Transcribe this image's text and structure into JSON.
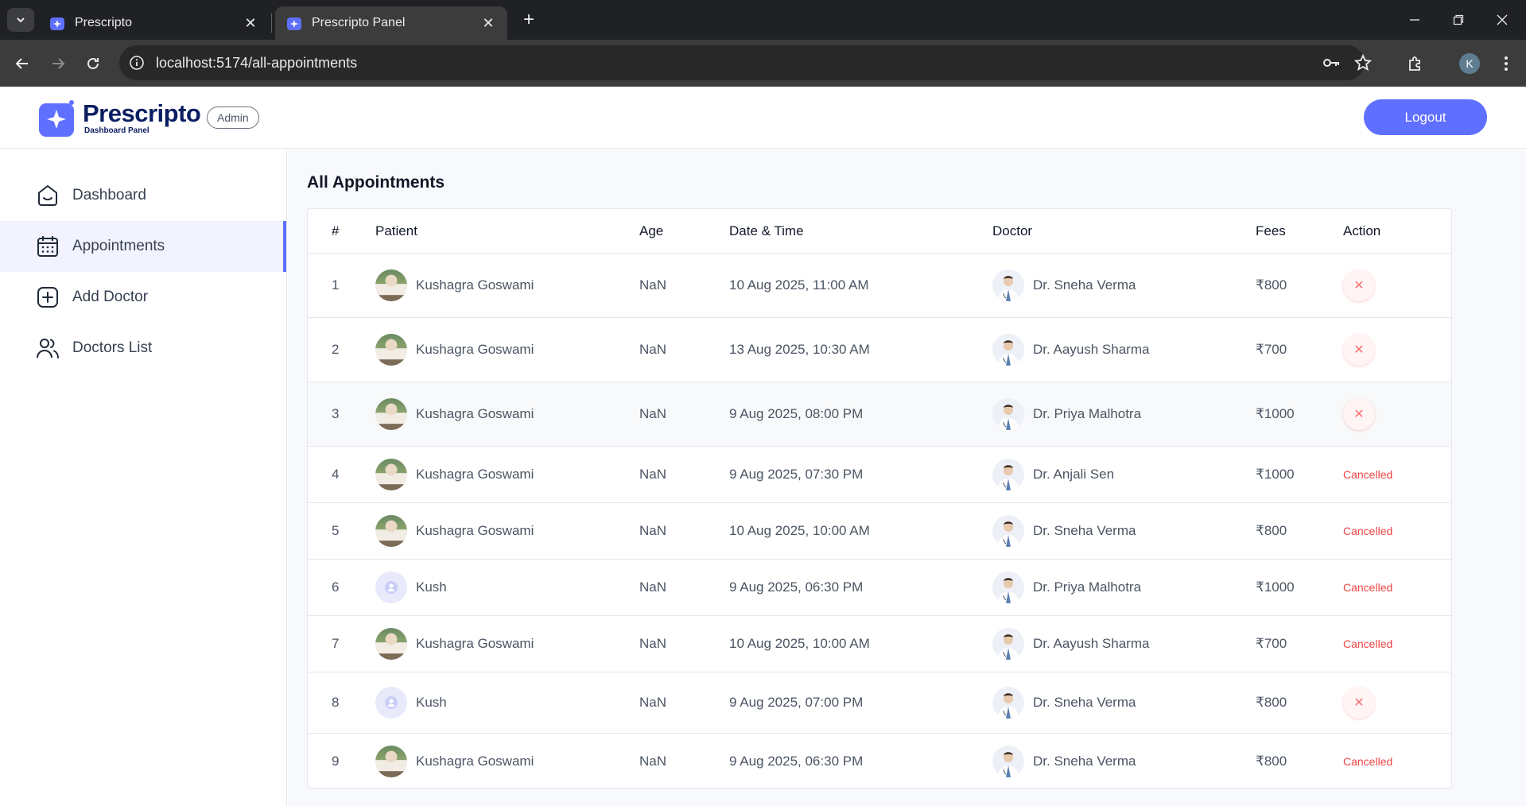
{
  "browser": {
    "tabs": [
      {
        "title": "Prescripto",
        "active": false
      },
      {
        "title": "Prescripto Panel",
        "active": true
      }
    ],
    "url": "localhost:5174/all-appointments",
    "profile_initial": "K"
  },
  "header": {
    "brand": "Prescripto",
    "subtitle": "Dashboard Panel",
    "role_badge": "Admin",
    "logout_label": "Logout"
  },
  "sidebar": {
    "items": [
      {
        "label": "Dashboard",
        "icon": "home-icon",
        "active": false
      },
      {
        "label": "Appointments",
        "icon": "calendar-icon",
        "active": true
      },
      {
        "label": "Add Doctor",
        "icon": "add-square-icon",
        "active": false
      },
      {
        "label": "Doctors List",
        "icon": "people-icon",
        "active": false
      }
    ]
  },
  "main": {
    "title": "All Appointments",
    "columns": [
      "#",
      "Patient",
      "Age",
      "Date & Time",
      "Doctor",
      "Fees",
      "Action"
    ],
    "rows": [
      {
        "no": "1",
        "patient": "Kushagra Goswami",
        "patient_avatar": "photo",
        "age": "NaN",
        "datetime": "10 Aug 2025, 11:00 AM",
        "doctor": "Dr. Sneha Verma",
        "fees": "₹800",
        "action": "cancel",
        "action_icon": "close-icon"
      },
      {
        "no": "2",
        "patient": "Kushagra Goswami",
        "patient_avatar": "photo",
        "age": "NaN",
        "datetime": "13 Aug 2025, 10:30 AM",
        "doctor": "Dr. Aayush Sharma",
        "fees": "₹700",
        "action": "cancel",
        "action_icon": "close-icon"
      },
      {
        "no": "3",
        "patient": "Kushagra Goswami",
        "patient_avatar": "photo",
        "age": "NaN",
        "datetime": "9 Aug 2025, 08:00 PM",
        "doctor": "Dr. Priya Malhotra",
        "fees": "₹1000",
        "action": "cancel",
        "action_icon": "close-icon"
      },
      {
        "no": "4",
        "patient": "Kushagra Goswami",
        "patient_avatar": "photo",
        "age": "NaN",
        "datetime": "9 Aug 2025, 07:30 PM",
        "doctor": "Dr. Anjali Sen",
        "fees": "₹1000",
        "action": "Cancelled"
      },
      {
        "no": "5",
        "patient": "Kushagra Goswami",
        "patient_avatar": "photo",
        "age": "NaN",
        "datetime": "10 Aug 2025, 10:00 AM",
        "doctor": "Dr. Sneha Verma",
        "fees": "₹800",
        "action": "Cancelled"
      },
      {
        "no": "6",
        "patient": "Kush",
        "patient_avatar": "blank",
        "age": "NaN",
        "datetime": "9 Aug 2025, 06:30 PM",
        "doctor": "Dr. Priya Malhotra",
        "fees": "₹1000",
        "action": "Cancelled"
      },
      {
        "no": "7",
        "patient": "Kushagra Goswami",
        "patient_avatar": "photo",
        "age": "NaN",
        "datetime": "10 Aug 2025, 10:00 AM",
        "doctor": "Dr. Aayush Sharma",
        "fees": "₹700",
        "action": "Cancelled"
      },
      {
        "no": "8",
        "patient": "Kush",
        "patient_avatar": "blank",
        "age": "NaN",
        "datetime": "9 Aug 2025, 07:00 PM",
        "doctor": "Dr. Sneha Verma",
        "fees": "₹800",
        "action": "cancel",
        "action_icon": "close-icon"
      },
      {
        "no": "9",
        "patient": "Kushagra Goswami",
        "patient_avatar": "photo",
        "age": "NaN",
        "datetime": "9 Aug 2025, 06:30 PM",
        "doctor": "Dr. Sneha Verma",
        "fees": "₹800",
        "action": "Cancelled"
      }
    ]
  },
  "colors": {
    "accent": "#5f6fff",
    "brand": "#0b1e62",
    "danger": "#ef4444",
    "active_bg": "#f2f3ff"
  }
}
